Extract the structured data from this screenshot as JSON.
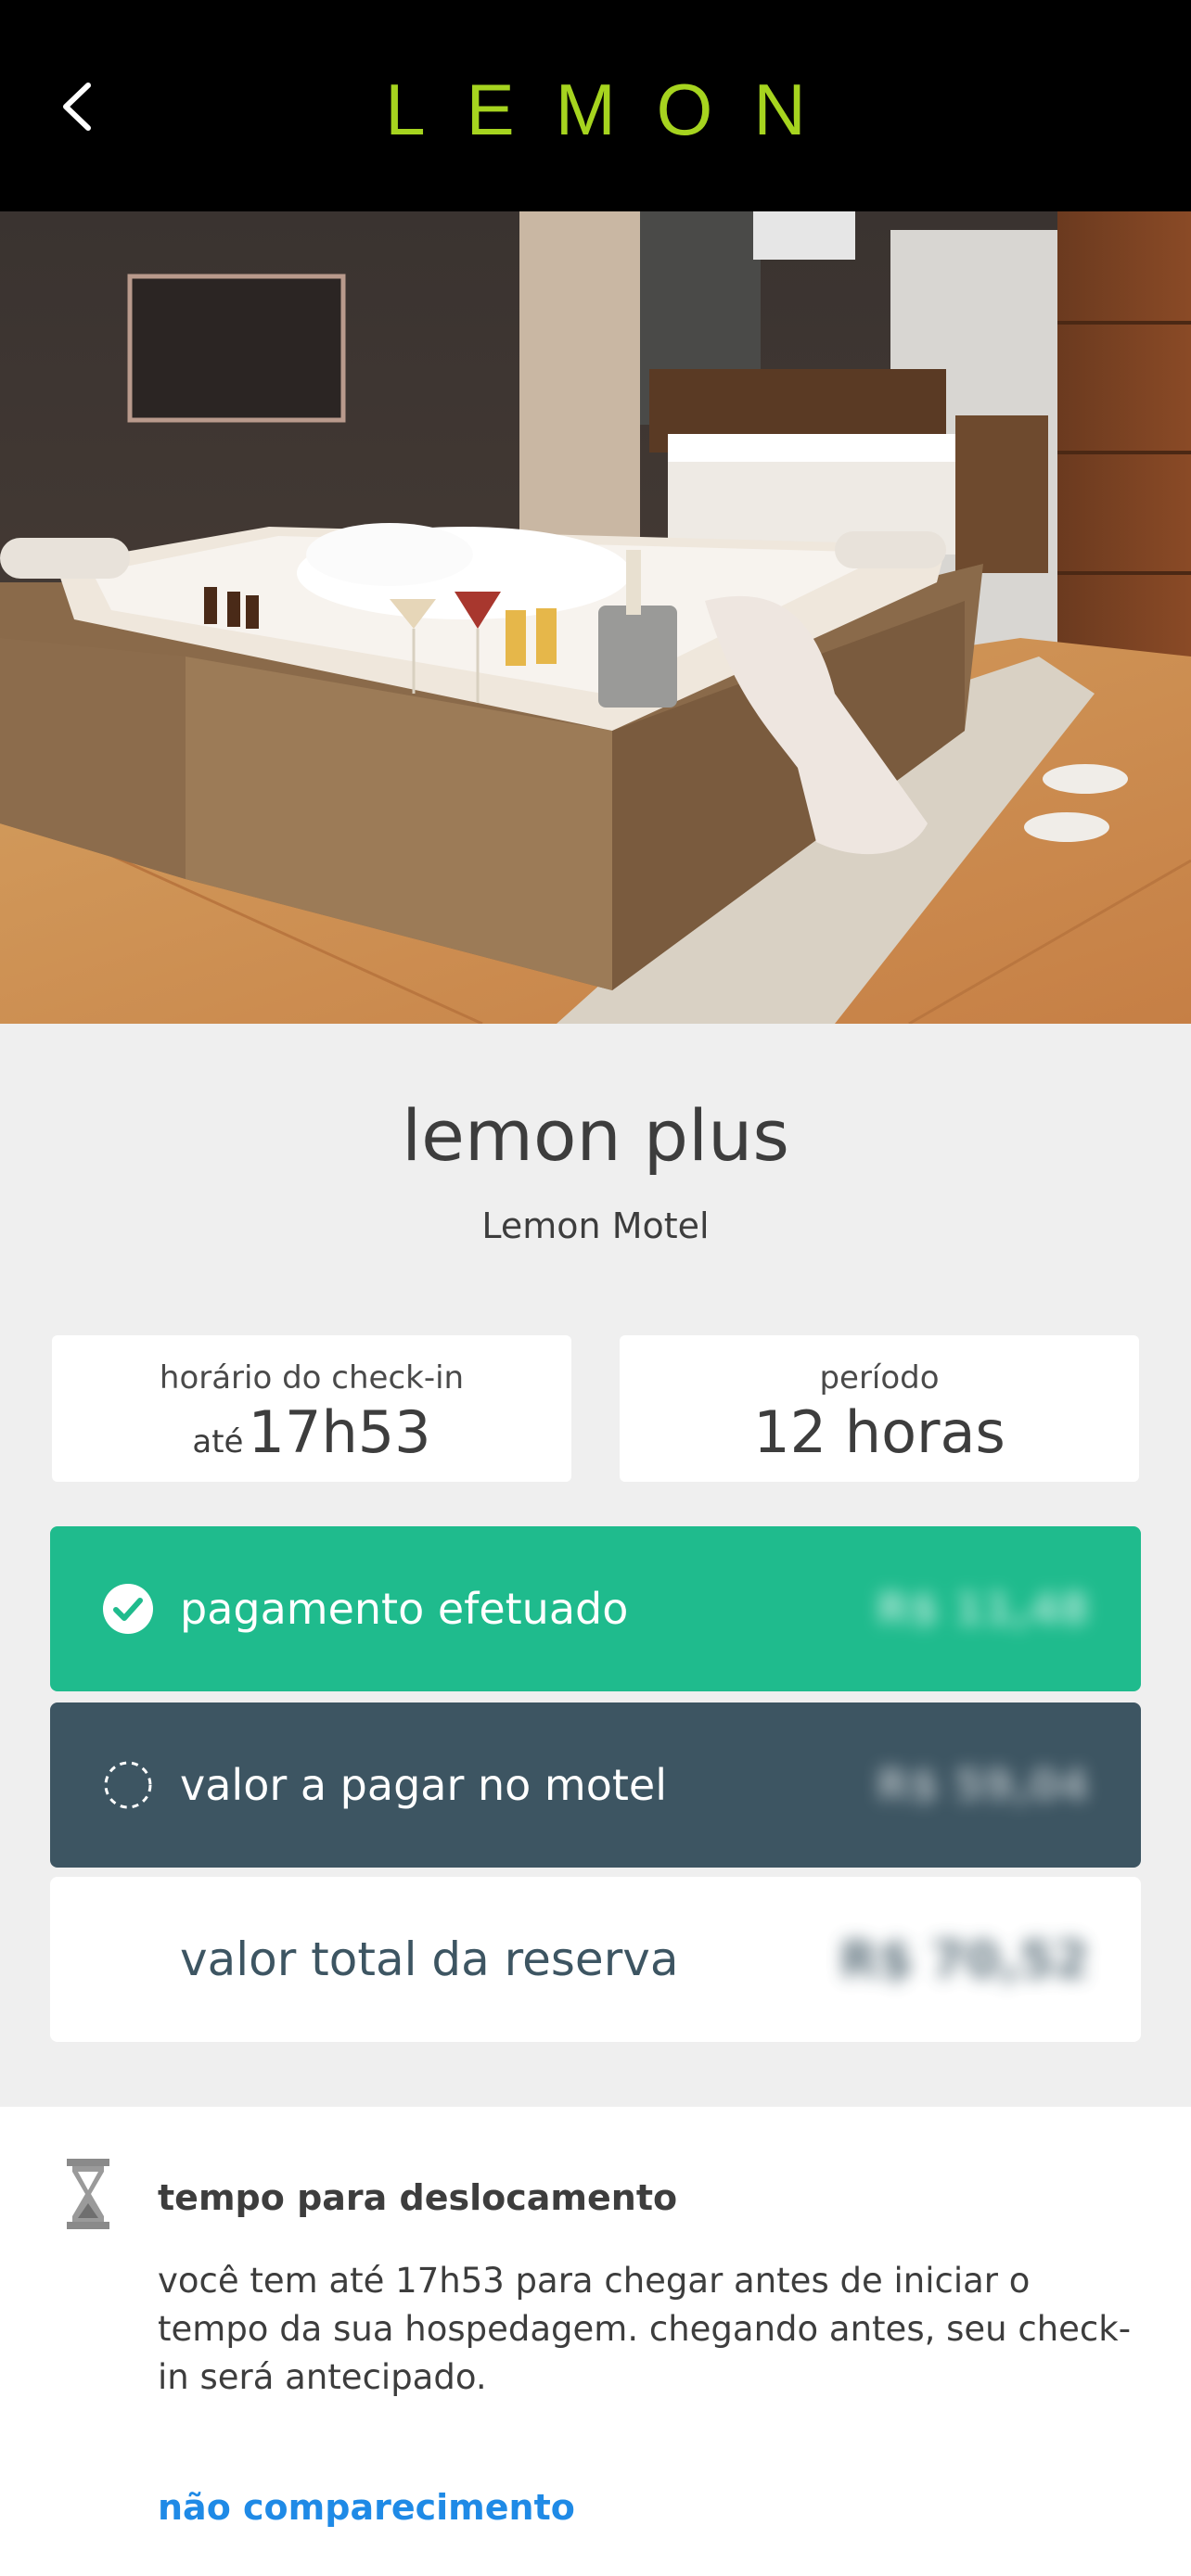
{
  "header": {
    "logo": "LEMON",
    "back_icon": "chevron-left-icon",
    "logo_color": "#a6d41f"
  },
  "room": {
    "title": "lemon plus",
    "motel": "Lemon Motel"
  },
  "checkin": {
    "label": "horário do check-in",
    "prefix": "até",
    "time": "17h53"
  },
  "period": {
    "label": "período",
    "value": "12 horas"
  },
  "payments": {
    "paid": {
      "label": "pagamento efetuado",
      "amount": "R$ 11,48",
      "icon": "check-circle-icon",
      "color": "#1fbb8d"
    },
    "due": {
      "label": "valor a pagar no motel",
      "amount": "R$ 59,04",
      "icon": "dashed-circle-icon",
      "color": "#3d5562"
    },
    "total": {
      "label": "valor total da reserva",
      "amount": "R$ 70,52"
    }
  },
  "travel": {
    "icon": "hourglass-icon",
    "title": "tempo para deslocamento",
    "text": "você tem até 17h53 para chegar antes de iniciar o tempo da sua hospedagem. chegando antes, seu check-in será antecipado."
  },
  "no_show": {
    "label": "não comparecimento",
    "color": "#1f8ae6"
  }
}
